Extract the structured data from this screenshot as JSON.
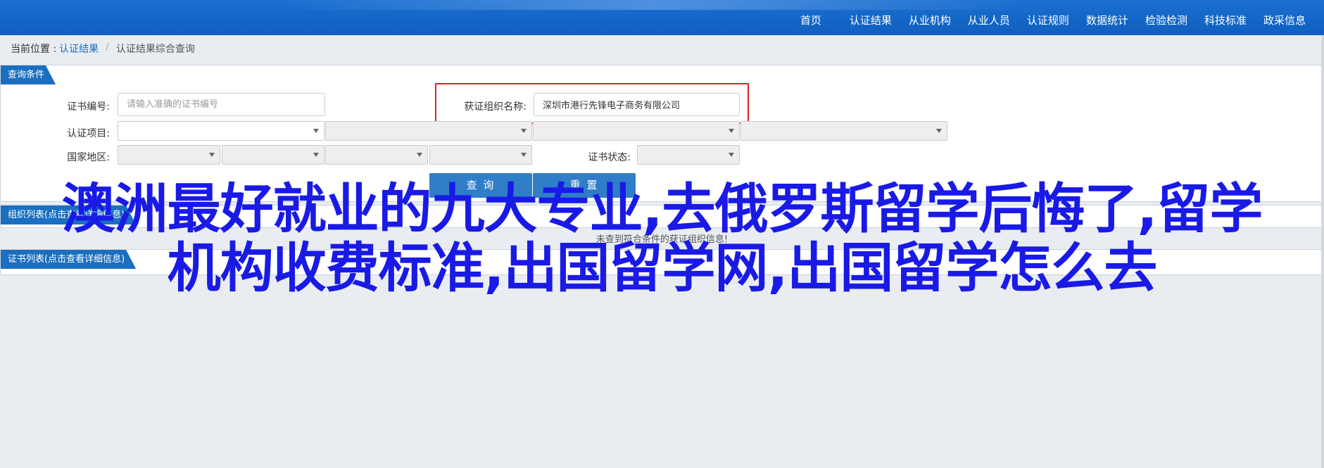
{
  "nav": [
    "首页",
    "认证结果",
    "从业机构",
    "从业人员",
    "认证规则",
    "数据统计",
    "检验检测",
    "科技标准",
    "政采信息"
  ],
  "breadcrumb": {
    "prefix": "当前位置 :",
    "link": "认证结果",
    "current": "认证结果综合查询"
  },
  "panels": {
    "query": "查询条件",
    "org_list": "组织列表(点击查看详细信息)",
    "cert_list": "证书列表(点击查看详细信息)"
  },
  "form": {
    "cert_no_label": "证书编号:",
    "cert_no_placeholder": "请输入准确的证书编号",
    "org_name_label": "获证组织名称:",
    "org_name_value": "深圳市港行先锋电子商务有限公司",
    "item_label": "认证项目:",
    "region_label": "国家地区:",
    "status_label": "证书状态:",
    "query_button": "查 询",
    "reset_button": "重 置"
  },
  "empty_msg": "未查到符合条件的获证组织信息!",
  "overlay": {
    "line1": "澳洲最好就业的九大专业,去俄罗斯留学后悔了,留学",
    "line2": "机构收费标准,出国留学网,出国留学怎么去"
  }
}
